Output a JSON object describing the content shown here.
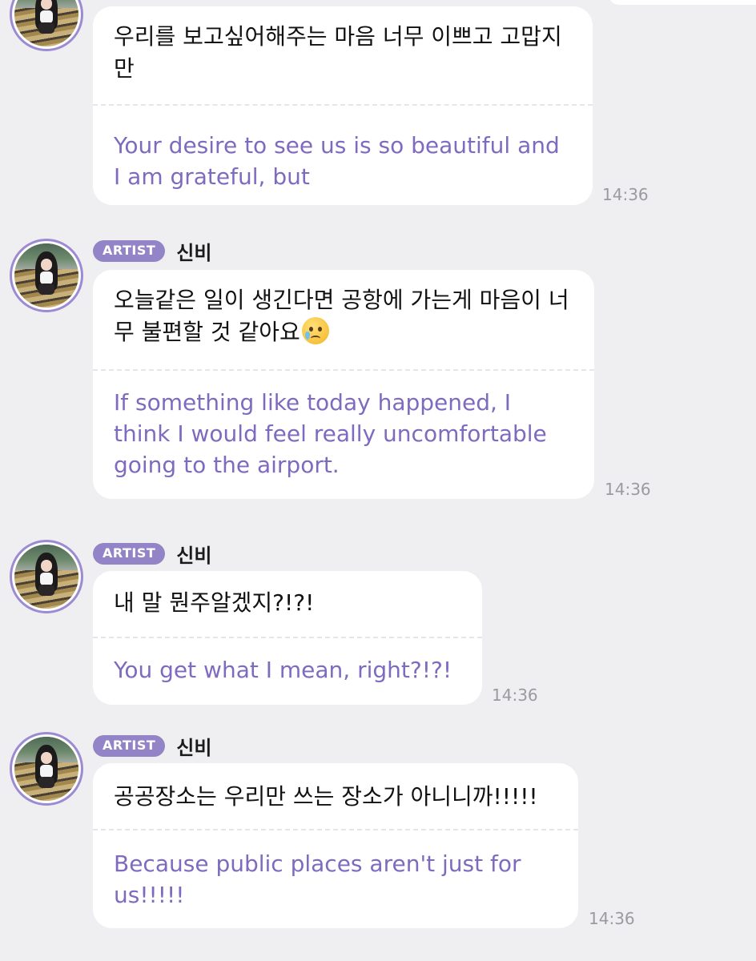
{
  "messages": [
    {
      "badge": "",
      "name": "",
      "korean": "우리를 보고싶어해주는 마음 너무 이쁘고 고맙지만",
      "english": "Your desire to see us is so beautiful and I am grateful, but",
      "time": "14:36"
    },
    {
      "badge": "ARTIST",
      "name": "신비",
      "korean": "오늘같은 일이 생긴다면 공항에 가는게 마음이 너무 불편할 것 같아요",
      "emoji": "crying-smile-emoji",
      "english": "If something like today happened, I think I would feel really uncomfortable going to the airport.",
      "time": "14:36"
    },
    {
      "badge": "ARTIST",
      "name": "신비",
      "korean": "내 말 뭔주알겠지?!?!",
      "english": "You get what I mean, right?!?!",
      "time": "14:36"
    },
    {
      "badge": "ARTIST",
      "name": "신비",
      "korean": "공공장소는 우리만 쓰는 장소가 아니니까!!!!!",
      "english": "Because public places aren't just for us!!!!!",
      "time": "14:36"
    }
  ],
  "colors": {
    "background": "#efeff1",
    "badge": "#9284c6",
    "translation_text": "#7e6bbf",
    "avatar_ring": "#9c8ad3"
  }
}
